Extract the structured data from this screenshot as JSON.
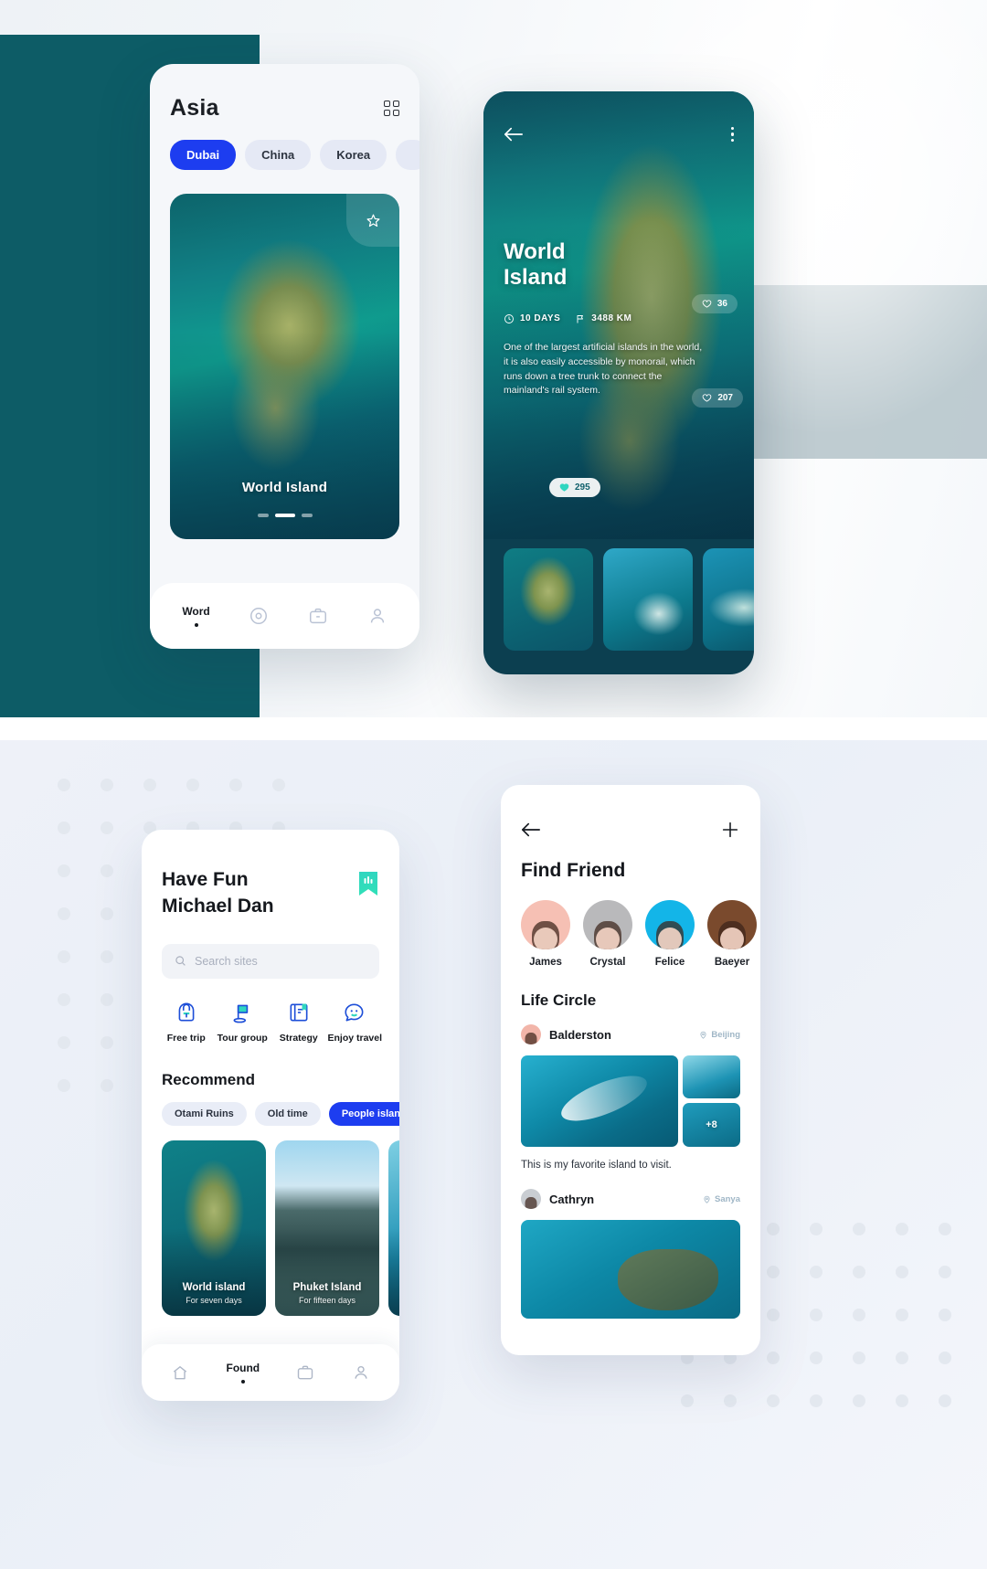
{
  "colors": {
    "accent_blue": "#1d3df0",
    "teal_dark": "#0d5c66",
    "mint": "#2fd6c0",
    "cat_blue": "#1d4ed8"
  },
  "phone_asia": {
    "title": "Asia",
    "grid_icon": "grid-icon",
    "chips": [
      {
        "label": "Dubai",
        "active": true
      },
      {
        "label": "China",
        "active": false
      },
      {
        "label": "Korea",
        "active": false
      },
      {
        "label": "",
        "active": false
      }
    ],
    "hero": {
      "caption": "World Island",
      "star_icon": "star-icon",
      "dots": 3,
      "active_dot": 2
    },
    "tabbar": [
      {
        "label": "Word",
        "icon": "word-label",
        "active": true
      },
      {
        "label": "",
        "icon": "compass-icon",
        "active": false
      },
      {
        "label": "",
        "icon": "briefcase-icon",
        "active": false
      },
      {
        "label": "",
        "icon": "person-icon",
        "active": false
      }
    ]
  },
  "phone_detail": {
    "back_icon": "back-arrow-icon",
    "menu_icon": "kebab-menu-icon",
    "title_line1": "World",
    "title_line2": "Island",
    "duration": "10 DAYS",
    "distance": "3488 KM",
    "duration_icon": "clock-icon",
    "distance_icon": "flag-icon",
    "description": "One of the largest artificial islands in the world, it is also easily accessible by monorail, which runs down a tree trunk to connect the mainland's rail system.",
    "likes": [
      {
        "count": "36",
        "filled": false
      },
      {
        "count": "207",
        "filled": false
      },
      {
        "count": "295",
        "filled": true
      }
    ],
    "thumbnails": [
      "island-thumb",
      "lagoon-thumb",
      "reef-thumb"
    ]
  },
  "phone_havefun": {
    "greeting_line1": "Have Fun",
    "greeting_line2": "Michael Dan",
    "bookmark_icon": "bookmark-icon",
    "search": {
      "placeholder": "Search sites",
      "icon": "search-icon",
      "value": ""
    },
    "categories": [
      {
        "label": "Free trip",
        "icon": "backpack-icon"
      },
      {
        "label": "Tour group",
        "icon": "flag-tour-icon"
      },
      {
        "label": "Strategy",
        "icon": "book-icon"
      },
      {
        "label": "Enjoy travel",
        "icon": "smiley-chat-icon"
      }
    ],
    "recommend_title": "Recommend",
    "recommend_chips": [
      {
        "label": "Otami Ruins",
        "active": false
      },
      {
        "label": "Old time",
        "active": false
      },
      {
        "label": "People island",
        "active": true
      }
    ],
    "recommend_cards": [
      {
        "title": "World island",
        "subtitle": "For seven days"
      },
      {
        "title": "Phuket Island",
        "subtitle": "For fifteen days"
      },
      {
        "title": "",
        "subtitle": ""
      }
    ],
    "tabbar": [
      {
        "label": "",
        "icon": "home-icon",
        "active": false
      },
      {
        "label": "Found",
        "icon": "found-label",
        "active": true
      },
      {
        "label": "",
        "icon": "briefcase-icon",
        "active": false
      },
      {
        "label": "",
        "icon": "person-icon",
        "active": false
      }
    ]
  },
  "phone_friend": {
    "back_icon": "back-arrow-icon",
    "add_icon": "plus-icon",
    "title": "Find Friend",
    "friends": [
      {
        "name": "James"
      },
      {
        "name": "Crystal"
      },
      {
        "name": "Felice"
      },
      {
        "name": "Baeyer"
      }
    ],
    "life_circle_title": "Life Circle",
    "posts": [
      {
        "author": "Balderston",
        "location": "Beijing",
        "location_icon": "pin-icon",
        "more_count": "+8",
        "text": "This is my favorite island to visit."
      },
      {
        "author": "Cathryn",
        "location": "Sanya",
        "location_icon": "pin-icon",
        "text": ""
      }
    ]
  }
}
